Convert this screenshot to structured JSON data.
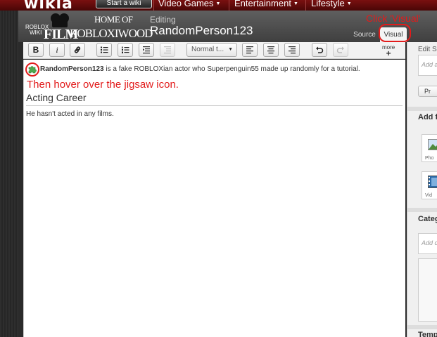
{
  "global_nav": {
    "logo": "wikia",
    "start_wiki": "Start a wiki",
    "items": [
      "Video Games",
      "Entertainment",
      "Lifestyle"
    ]
  },
  "wiki_logo": {
    "top_small": "ROBLOX",
    "top_small2": "WIKI",
    "film": "FILM",
    "home_of": "HOME OF",
    "big": "ROBLOXIWOOD"
  },
  "header": {
    "editing_label": "Editing",
    "page_name": "RandomPerson123",
    "tabs": {
      "source": "Source",
      "visual": "Visual"
    }
  },
  "toolbar": {
    "bold": "B",
    "italic": "i",
    "format_select": "Normal t...",
    "more": "more"
  },
  "content": {
    "intro_bold": "RandomPerson123",
    "intro_rest": " is a fake ROBLOXian actor who Superpenguin55 made up randomly for a tutorial.",
    "heading": "Acting Career",
    "body": "He hasn't acted in any films."
  },
  "rail": {
    "edit_summary_label": "Edit Su",
    "add_input_placeholder": "Add a",
    "preview_button": "Pr",
    "add_features_title": "Add f",
    "photo_tile": "Pho",
    "video_tile": "Vid",
    "categories_title": "Categ",
    "category_placeholder": "Add c",
    "templates_title": "Temp"
  },
  "annotations": {
    "click_visual": "Click 'Visual'",
    "hover_jigsaw": "Then hover over the jigsaw icon.",
    "color": "#e21b1b"
  }
}
